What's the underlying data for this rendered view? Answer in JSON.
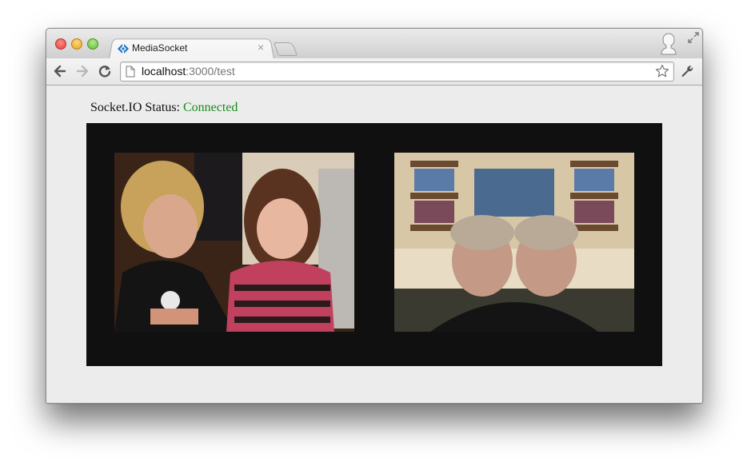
{
  "browser": {
    "tab": {
      "title": "MediaSocket",
      "close_glyph": "×"
    },
    "address": {
      "host": "localhost",
      "path": ":3000/test"
    }
  },
  "page": {
    "status_label": "Socket.IO Status:",
    "status_value": "Connected",
    "status_color": "#1b8a1b",
    "stage_color": "#101010"
  },
  "icons": [
    "back-arrow-icon",
    "forward-arrow-icon",
    "reload-icon",
    "page-icon",
    "star-icon",
    "wrench-icon",
    "profile-icon",
    "fullscreen-icon",
    "favicon-icon"
  ]
}
